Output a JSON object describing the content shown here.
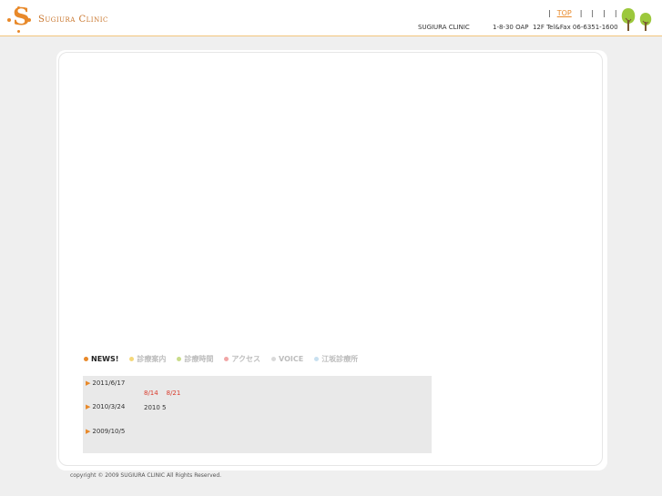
{
  "brand": {
    "name": "Sugiura Clinic",
    "logo_letter": "S",
    "accent": "#e8892a"
  },
  "topnav": {
    "items": [
      "TOP",
      "",
      "",
      "",
      ""
    ]
  },
  "header": {
    "clinic_name": "SUGIURA CLINIC",
    "address": "1-8-30 OAP  12F Tel&Fax 06-6351-1600"
  },
  "tabs": [
    {
      "label": "NEWS!",
      "color": "#e8892a",
      "text_color": "#222222"
    },
    {
      "label": "診療案内",
      "color": "#f5d87a",
      "text_color": "#bdbdbd"
    },
    {
      "label": "診療時間",
      "color": "#c9dc8a",
      "text_color": "#bdbdbd"
    },
    {
      "label": "アクセス",
      "color": "#f1a6a6",
      "text_color": "#bdbdbd"
    },
    {
      "label": "VOICE",
      "color": "#d9d9d9",
      "text_color": "#bdbdbd"
    },
    {
      "label": "江坂診療所",
      "color": "#c8e0f0",
      "text_color": "#bdbdbd"
    }
  ],
  "news": {
    "items": [
      {
        "date": "2011/6/17"
      },
      {
        "date": "2010/3/24",
        "text": "2010 5"
      },
      {
        "date": "2009/10/5"
      }
    ],
    "highlight": "8/14    8/21"
  },
  "footer": {
    "copyright": "copyright © 2009 SUGIURA CLINIC All Rights Reserved."
  }
}
